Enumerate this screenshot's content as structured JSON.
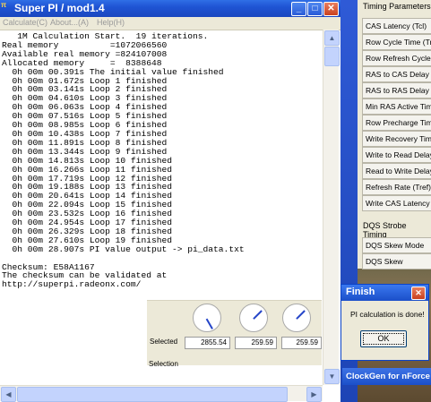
{
  "pi_window": {
    "title": "Super PI / mod1.4",
    "menu": [
      "Calculate(C)",
      "About...(A)",
      "Help(H)"
    ],
    "output_lines": [
      "   1M Calculation Start.  19 iterations.",
      "Real memory          =1072066560",
      "Available real memory =824107008",
      "Allocated memory     =  8388648",
      "  0h 00m 00.391s The initial value finished",
      "  0h 00m 01.672s Loop 1 finished",
      "  0h 00m 03.141s Loop 2 finished",
      "  0h 00m 04.610s Loop 3 finished",
      "  0h 00m 06.063s Loop 4 finished",
      "  0h 00m 07.516s Loop 5 finished",
      "  0h 00m 08.985s Loop 6 finished",
      "  0h 00m 10.438s Loop 7 finished",
      "  0h 00m 11.891s Loop 8 finished",
      "  0h 00m 13.344s Loop 9 finished",
      "  0h 00m 14.813s Loop 10 finished",
      "  0h 00m 16.266s Loop 11 finished",
      "  0h 00m 17.719s Loop 12 finished",
      "  0h 00m 19.188s Loop 13 finished",
      "  0h 00m 20.641s Loop 14 finished",
      "  0h 00m 22.094s Loop 15 finished",
      "  0h 00m 23.532s Loop 16 finished",
      "  0h 00m 24.954s Loop 17 finished",
      "  0h 00m 26.329s Loop 18 finished",
      "  0h 00m 27.610s Loop 19 finished",
      "  0h 00m 28.907s PI value output -> pi_data.txt",
      "",
      "Checksum: E58A1167",
      "The checksum can be validated at",
      "http://superpi.radeonx.com/"
    ]
  },
  "gauges": {
    "selected_label": "Selected",
    "values": [
      "2855.54",
      "259.59",
      "259.59"
    ],
    "selection_label": "Selection"
  },
  "timing_panel": {
    "title": "Timing Parameters",
    "items": [
      "CAS Latency (Tcl)",
      "Row Cycle Time (Trc)",
      "Row Refresh Cycle Time",
      "RAS to CAS Delay (Trcd)",
      "RAS to RAS Delay (Trrd)",
      "Min RAS Active Time",
      "Row Precharge Time",
      "Write Recovery Time",
      "Write to Read Delay",
      "Read to Write Delay",
      "Refresh Rate (Tref)",
      "Write CAS Latency (Tw"
    ],
    "dqs_title": "DQS Strobe Timing",
    "dqs_items": [
      "DQS Skew Mode",
      "DQS Skew"
    ]
  },
  "clockgen": {
    "title": "ClockGen for nForce"
  },
  "finish_dialog": {
    "title": "Finish",
    "message": "PI calculation is done!",
    "ok_label": "OK"
  }
}
